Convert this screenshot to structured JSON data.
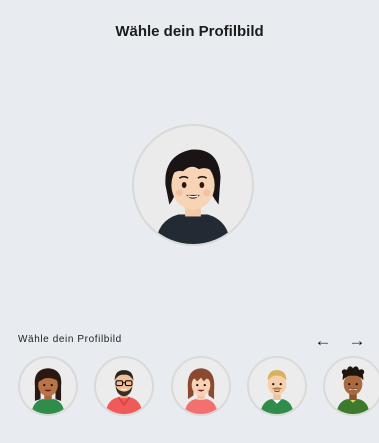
{
  "header": {
    "title": "Wähle dein Profilbild"
  },
  "preview": {
    "selected_avatar": "avatar-short-dark-hair-woman"
  },
  "picker": {
    "label": "Wähle dein Profilbild",
    "prev_icon": "arrow-left-icon",
    "next_icon": "arrow-right-icon",
    "prev_glyph": "←",
    "next_glyph": "→",
    "avatars": [
      "avatar-long-hair-woman-green-shirt",
      "avatar-bearded-man-glasses-red-hoodie",
      "avatar-red-hair-woman-pink-shirt",
      "avatar-blond-man-mustache-green-shirt",
      "avatar-curly-hair-man-green-shirt"
    ]
  },
  "colors": {
    "background": "#e8ebf0",
    "avatar_bg": "#ebebeb",
    "green_shirt": "#2f8c4a",
    "red_shirt": "#f05a5a"
  }
}
